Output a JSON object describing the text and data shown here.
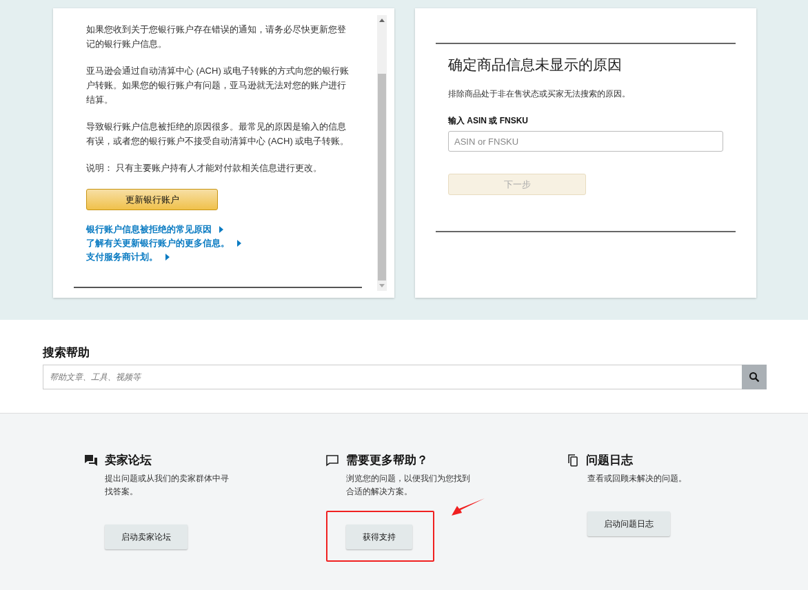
{
  "bank_card": {
    "paragraphs": [
      "如果您收到关于您银行账户存在错误的通知，请务必尽快更新您登记的银行账户信息。",
      "亚马逊会通过自动清算中心 (ACH) 或电子转账的方式向您的银行账户转账。如果您的银行账户有问题，亚马逊就无法对您的账户进行结算。",
      "导致银行账户信息被拒绝的原因很多。最常见的原因是输入的信息有误，或者您的银行账户不接受自动清算中心 (ACH) 或电子转账。",
      "说明： 只有主要账户持有人才能对付款相关信息进行更改。"
    ],
    "button": "更新银行账户",
    "links": [
      "银行账户信息被拒绝的常见原因",
      "了解有关更新银行账户的更多信息。",
      "支付服务商计划。"
    ]
  },
  "listing_card": {
    "title": "确定商品信息未显示的原因",
    "description": "排除商品处于非在售状态或买家无法搜索的原因。",
    "field_label": "输入 ASIN 或 FNSKU",
    "placeholder": "ASIN or FNSKU",
    "button": {
      "label": "下一步",
      "disabled": true
    }
  },
  "search": {
    "title": "搜索帮助",
    "placeholder": "帮助文章、工具、视频等"
  },
  "help_columns": [
    {
      "kind": "forum",
      "title": "卖家论坛",
      "description": "提出问题或从我们的卖家群体中寻找答案。",
      "button": "启动卖家论坛",
      "highlighted": false
    },
    {
      "kind": "chat",
      "title": "需要更多帮助？",
      "description": "浏览您的问题，以便我们为您找到合适的解决方案。",
      "button": "获得支持",
      "highlighted": true
    },
    {
      "kind": "log",
      "title": "问题日志",
      "description": "查看或回顾未解决的问题。",
      "button": "启动问题日志",
      "highlighted": false
    }
  ]
}
